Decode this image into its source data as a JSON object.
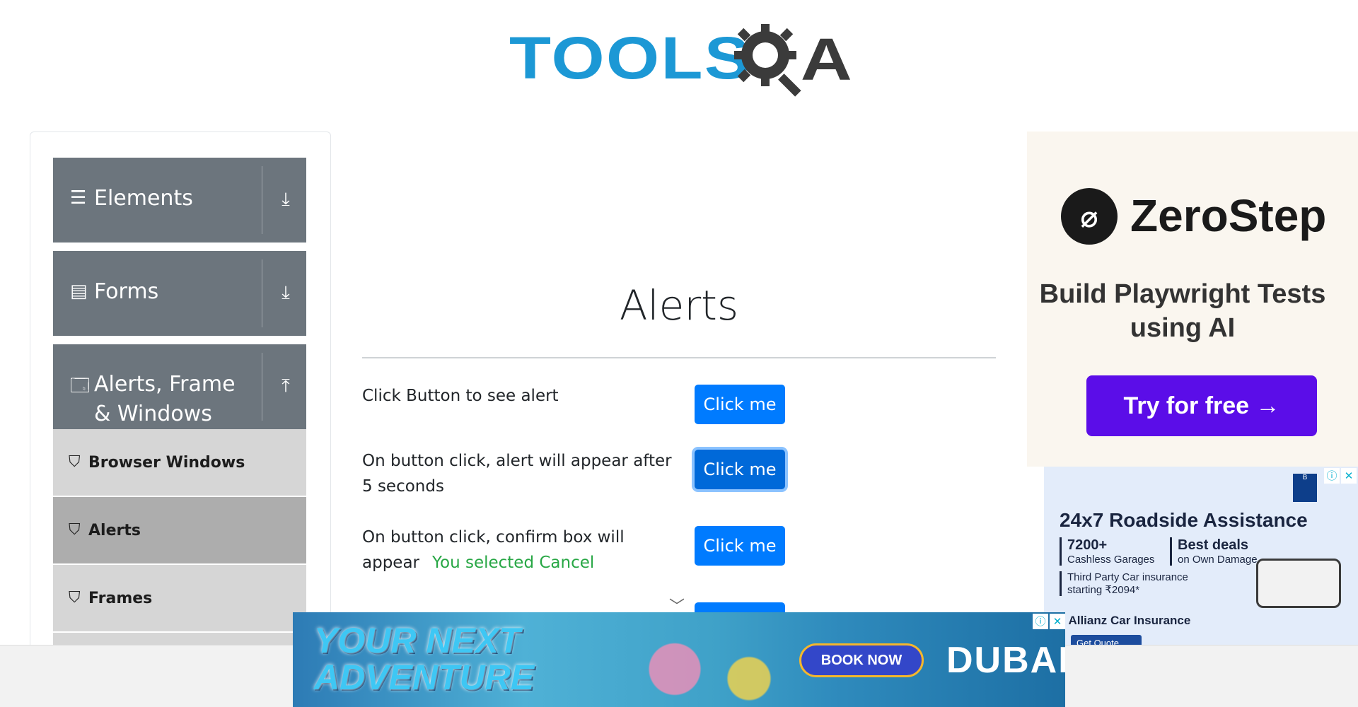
{
  "header": {
    "logo_primary": "TOOLS",
    "logo_secondary": "A"
  },
  "sidebar": {
    "groups": [
      {
        "label": "Elements",
        "icon": "hamburger-icon",
        "arrow": "download-arrow-icon",
        "state": "collapsed"
      },
      {
        "label": "Forms",
        "icon": "document-icon",
        "arrow": "download-arrow-icon",
        "state": "collapsed"
      },
      {
        "label": "Alerts, Frame & Windows",
        "icon": "window-icon",
        "arrow": "upload-arrow-icon",
        "state": "expanded"
      }
    ],
    "items": [
      {
        "label": "Browser Windows",
        "active": false
      },
      {
        "label": "Alerts",
        "active": true
      },
      {
        "label": "Frames",
        "active": false
      }
    ]
  },
  "main": {
    "title": "Alerts",
    "rows": [
      {
        "text": "Click Button to see alert",
        "button": "Click me"
      },
      {
        "text": "On button click, alert will appear after 5 seconds",
        "button": "Click me"
      },
      {
        "text": "On button click, confirm box will appear",
        "result": "You selected Cancel",
        "button": "Click me"
      }
    ]
  },
  "ads": {
    "right_top": {
      "brand": "ZeroStep",
      "tagline": "Build Playwright Tests using AI",
      "cta": "Try for free →"
    },
    "right_bottom": {
      "title": "24x7 Roadside Assistance",
      "c1_big": "7200+",
      "c1_small": "Cashless Garages",
      "c2_big": "Best deals",
      "c2_small": "on Own Damage",
      "c3_line1": "Third Party Car insurance",
      "c3_line2": "starting ₹2094*",
      "brand": "ajaj Allianz Car Insurance",
      "cta": "Get Quote"
    },
    "bottom": {
      "slogan_line1": "YOUR NEXT",
      "slogan_line2": "ADVENTURE",
      "cta": "BOOK NOW",
      "brand": "DUBAI"
    }
  },
  "colors": {
    "primary": "#007bff",
    "sidebar_group": "#6c757d",
    "success": "#28a745",
    "logo_blue": "#1c98d5"
  }
}
